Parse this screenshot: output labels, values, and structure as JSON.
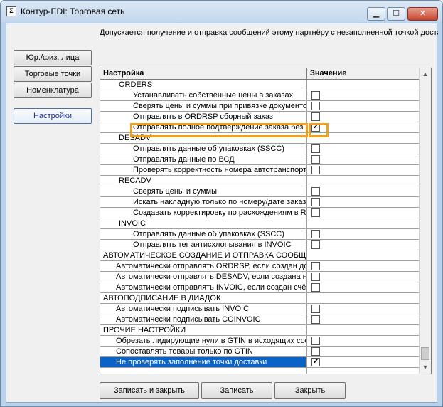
{
  "window": {
    "title": "Контур-EDI: Торговая сеть",
    "icon": "app-window-icon"
  },
  "info_text": "Допускается получение и отправка сообщений этому партнёру с незаполненной точкой доставки",
  "nav": [
    {
      "label": "Юр./физ. лица",
      "active": false
    },
    {
      "label": "Торговые точки",
      "active": false
    },
    {
      "label": "Номенклатура",
      "active": false
    },
    {
      "label": "Настройки",
      "active": true
    }
  ],
  "grid": {
    "columns": [
      "Настройка",
      "Значение"
    ],
    "rows": [
      {
        "label": "ORDERS",
        "indent": 2,
        "checkbox": false
      },
      {
        "label": "Устанавливать собственные цены в заказах",
        "indent": 3,
        "checkbox": true,
        "checked": false
      },
      {
        "label": "Сверять цены и суммы при привязке документов",
        "indent": 3,
        "checkbox": true,
        "checked": false
      },
      {
        "label": "Отправлять в ORDRSP сборный заказ",
        "indent": 3,
        "checkbox": true,
        "checked": false
      },
      {
        "label": "Отправлять полное подтверждение заказа без изменений",
        "indent": 3,
        "checkbox": true,
        "checked": true,
        "highlight": true
      },
      {
        "label": "DESADV",
        "indent": 2,
        "checkbox": false
      },
      {
        "label": "Отправлять данные об упаковках (SSCC)",
        "indent": 3,
        "checkbox": true,
        "checked": false
      },
      {
        "label": "Отправлять данные по ВСД",
        "indent": 3,
        "checkbox": true,
        "checked": false
      },
      {
        "label": "Проверять корректность номера автотранспорта",
        "indent": 3,
        "checkbox": true,
        "checked": false
      },
      {
        "label": "RECADV",
        "indent": 2,
        "checkbox": false
      },
      {
        "label": "Сверять цены и суммы",
        "indent": 3,
        "checkbox": true,
        "checked": false
      },
      {
        "label": "Искать накладную только по номеру/дате заказа",
        "indent": 3,
        "checkbox": true,
        "checked": false
      },
      {
        "label": "Создавать корректировку по расхождениям в RECADV",
        "indent": 3,
        "checkbox": true,
        "checked": false
      },
      {
        "label": "INVOIC",
        "indent": 2,
        "checkbox": false
      },
      {
        "label": "Отправлять данные об упаковках (SSCC)",
        "indent": 3,
        "checkbox": true,
        "checked": false
      },
      {
        "label": "Отправлять тег антисхлопывания в INVOIC",
        "indent": 3,
        "checkbox": true,
        "checked": false
      },
      {
        "label": "АВТОМАТИЧЕСКОЕ СОЗДАНИЕ И ОТПРАВКА СООБЩЕНИЙ",
        "indent": 0,
        "checkbox": false
      },
      {
        "label": "Автоматически отправлять ORDRSP, если создан документ",
        "indent": 1,
        "checkbox": true,
        "checked": false
      },
      {
        "label": "Автоматически отправлять DESADV, если создана накладная",
        "indent": 1,
        "checkbox": true,
        "checked": false
      },
      {
        "label": "Автоматически отправлять INVOIC, если создан счёт-фактура",
        "indent": 1,
        "checkbox": true,
        "checked": false
      },
      {
        "label": "АВТОПОДПИСАНИЕ В ДИАДОК",
        "indent": 0,
        "checkbox": false
      },
      {
        "label": "Автоматически подписывать INVOIC",
        "indent": 1,
        "checkbox": true,
        "checked": false
      },
      {
        "label": "Автоматически подписывать COINVOIC",
        "indent": 1,
        "checkbox": true,
        "checked": false
      },
      {
        "label": "ПРОЧИЕ НАСТРОЙКИ",
        "indent": 0,
        "checkbox": false
      },
      {
        "label": "Обрезать лидирующие нули в GTIN в исходящих сообщениях",
        "indent": 1,
        "checkbox": true,
        "checked": false
      },
      {
        "label": "Сопоставлять товары только по GTIN",
        "indent": 1,
        "checkbox": true,
        "checked": false
      },
      {
        "label": "Не проверять заполнение точки доставки",
        "indent": 1,
        "checkbox": true,
        "checked": true,
        "highlight": true,
        "selected": true
      }
    ]
  },
  "actions": {
    "save_close": "Записать и закрыть",
    "save": "Записать",
    "close": "Закрыть"
  }
}
